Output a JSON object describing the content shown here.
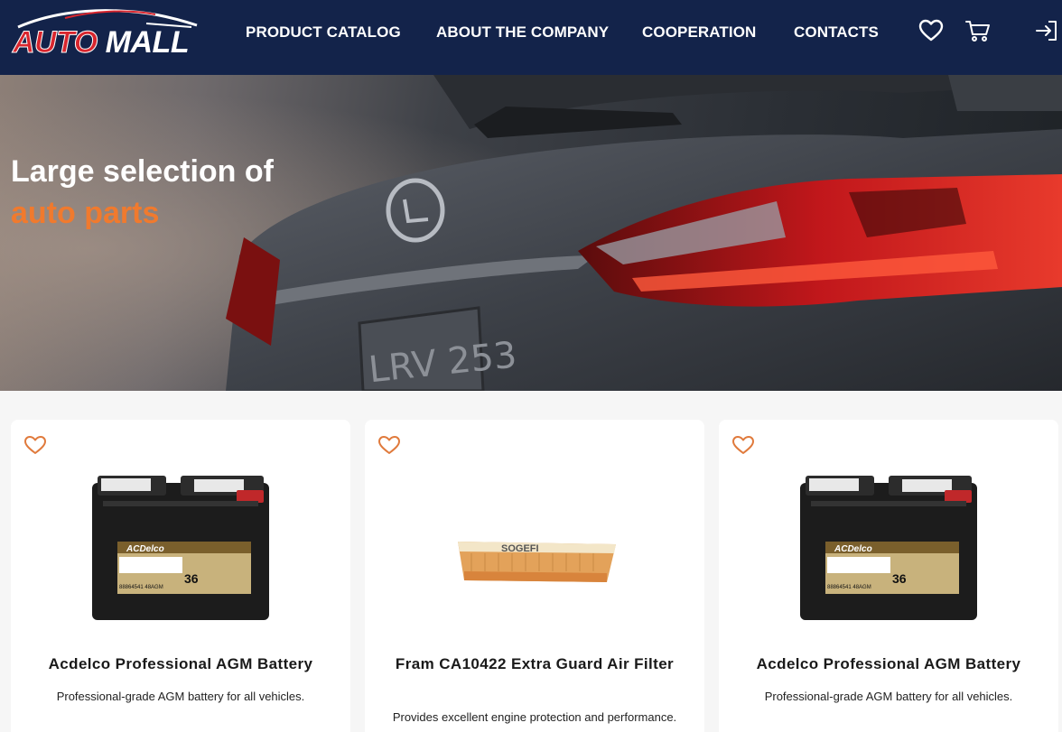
{
  "brand": {
    "logo_auto": "AUTO",
    "logo_mall": "MALL"
  },
  "nav": {
    "items": [
      {
        "label": "PRODUCT CATALOG"
      },
      {
        "label": "ABOUT THE COMPANY"
      },
      {
        "label": "COOPERATION"
      },
      {
        "label": "CONTACTS"
      }
    ],
    "icons": [
      "heart-icon",
      "cart-icon",
      "login-icon"
    ]
  },
  "hero": {
    "title_line1": "Large selection of",
    "title_line2": "auto parts",
    "plate_text": "LRV 253"
  },
  "products": [
    {
      "name": "Acdelco Professional AGM Battery",
      "description": "Professional-grade AGM battery for all vehicles.",
      "image": "battery",
      "label_brand": "ACDelco",
      "label_number": "36",
      "label_code": "88864541 48AGM"
    },
    {
      "name": "Fram CA10422 Extra Guard Air Filter",
      "description": "Provides excellent engine protection and performance.",
      "image": "air-filter",
      "label_brand": "SOGEFI"
    },
    {
      "name": "Acdelco Professional AGM Battery",
      "description": "Professional-grade AGM battery for all vehicles.",
      "image": "battery",
      "label_brand": "ACDelco",
      "label_number": "36",
      "label_code": "88864541 48AGM"
    }
  ],
  "colors": {
    "header_bg": "#13234a",
    "accent": "#f07a2e",
    "logo_red": "#d8262e",
    "favorite_outline": "#e07a3c"
  }
}
